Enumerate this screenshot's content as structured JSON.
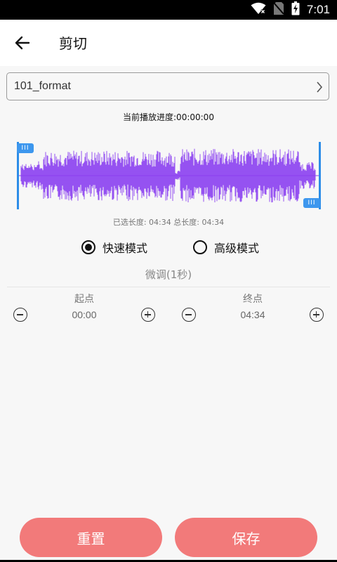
{
  "status_bar": {
    "time": "7:01",
    "icons": [
      "wifi-icon",
      "no-sim-icon",
      "battery-charging-icon"
    ]
  },
  "header": {
    "title": "剪切",
    "back_icon": "arrow-left-icon"
  },
  "file": {
    "name": "101_format",
    "chevron_icon": "chevron-right-icon"
  },
  "playback": {
    "progress_text": "当前播放进度:00:00:00"
  },
  "waveform": {
    "color": "#8a3ff0",
    "handle_color": "#3d97ee",
    "handle_grip": "III"
  },
  "selection": {
    "length_text": "已选长度: 04:34 总长度: 04:34"
  },
  "modes": [
    {
      "label": "快速模式",
      "selected": true
    },
    {
      "label": "高级模式",
      "selected": false
    }
  ],
  "fine_tune": {
    "title": "微调(1秒)",
    "start": {
      "label": "起点",
      "value": "00:00"
    },
    "end": {
      "label": "终点",
      "value": "04:34"
    }
  },
  "actions": {
    "reset_label": "重置",
    "save_label": "保存",
    "button_color": "#f27a7a"
  }
}
